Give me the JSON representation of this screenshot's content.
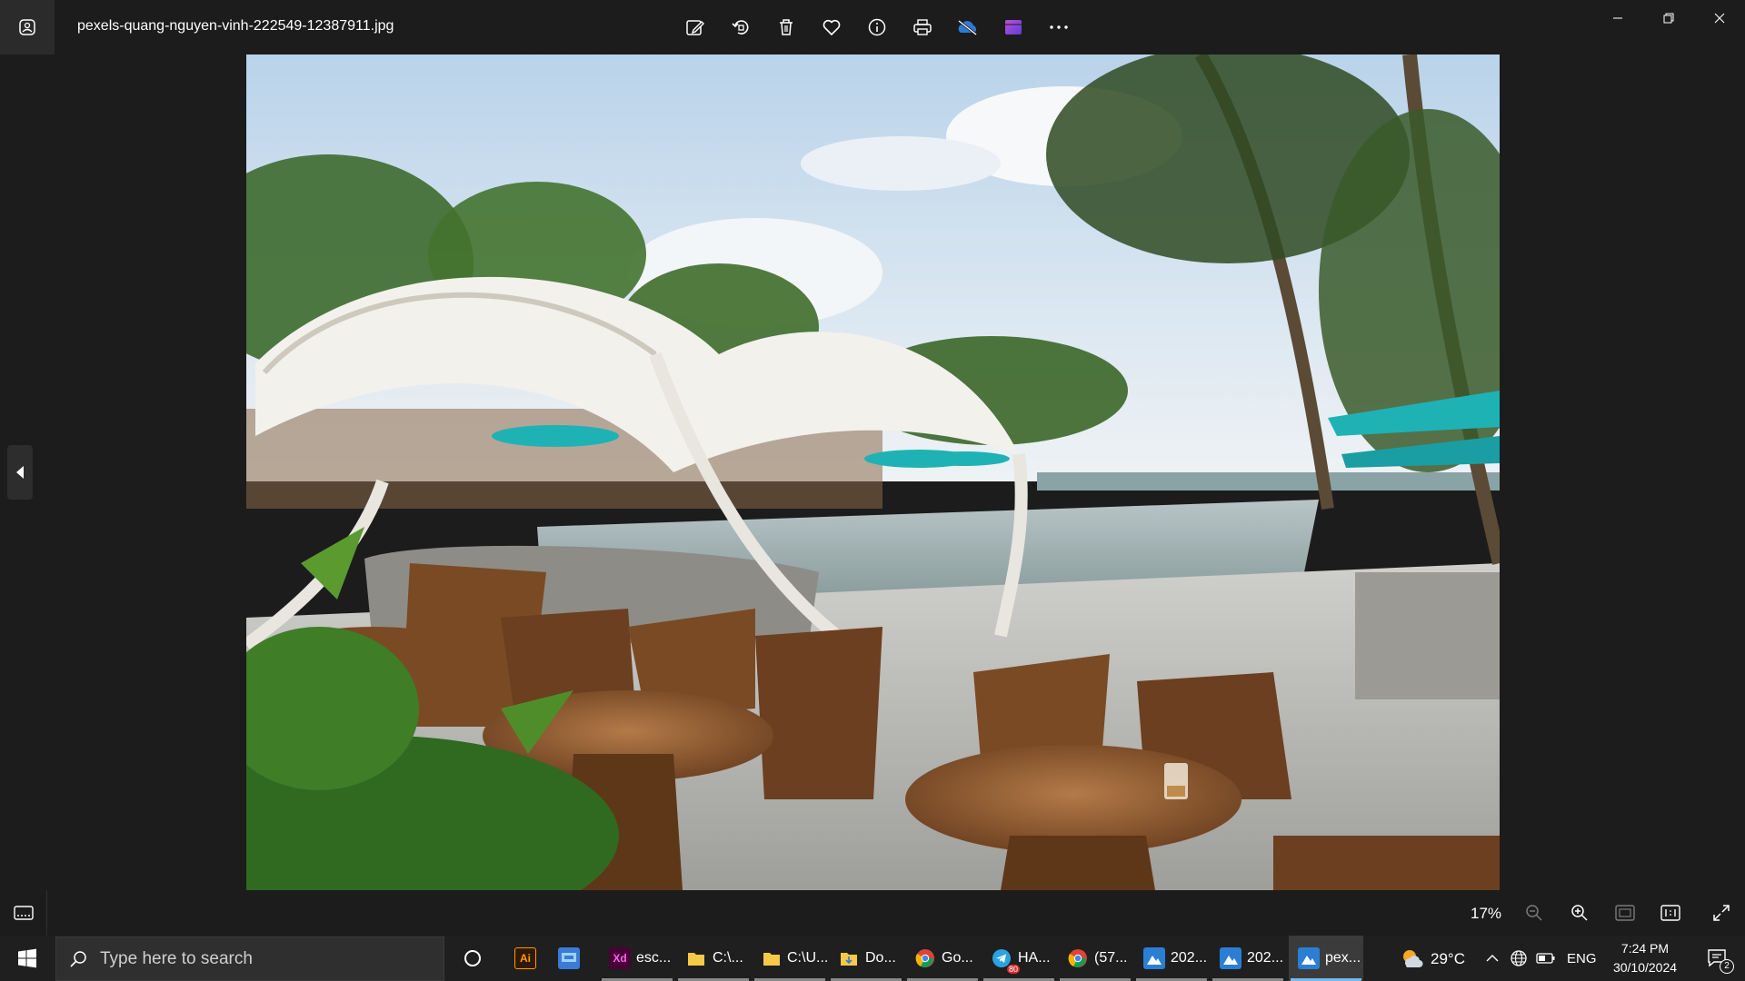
{
  "window": {
    "filename": "pexels-quang-nguyen-vinh-222549-12387911.jpg",
    "toolbar": [
      "edit-image-icon",
      "rotate-icon",
      "delete-icon",
      "favorite-icon",
      "info-icon",
      "print-icon",
      "onedrive-icon",
      "clipchamp-icon",
      "more-options-icon"
    ]
  },
  "bottombar": {
    "zoom": "17%"
  },
  "taskbar": {
    "search_placeholder": "Type here to search",
    "apps": [
      {
        "name": "Adobe Illustrator",
        "label": "",
        "icon_text": "Ai"
      },
      {
        "name": "Control Panel",
        "label": "",
        "icon_text": ""
      },
      {
        "name": "Adobe XD",
        "label": "esc...",
        "icon_text": "Xd"
      },
      {
        "name": "File Explorer",
        "label": "C:\\...",
        "icon_text": ""
      },
      {
        "name": "File Explorer 2",
        "label": "C:\\U...",
        "icon_text": ""
      },
      {
        "name": "Downloads",
        "label": "Do...",
        "icon_text": ""
      },
      {
        "name": "Chrome Google",
        "label": "Go...",
        "icon_text": ""
      },
      {
        "name": "Telegram",
        "label": "HA...",
        "icon_text": "",
        "badge": "80"
      },
      {
        "name": "Chrome",
        "label": "(57...",
        "icon_text": ""
      },
      {
        "name": "Photos 1",
        "label": "202...",
        "icon_text": ""
      },
      {
        "name": "Photos 2",
        "label": "202...",
        "icon_text": ""
      },
      {
        "name": "Photos active",
        "label": "pex...",
        "icon_text": ""
      }
    ],
    "weather": "29°C",
    "language": "ENG",
    "time": "7:24 PM",
    "date": "30/10/2024",
    "notifications": "2"
  },
  "colors": {
    "accent": "#76b9ed",
    "background": "#1c1c1c",
    "taskbar": "#1f1f1f"
  }
}
